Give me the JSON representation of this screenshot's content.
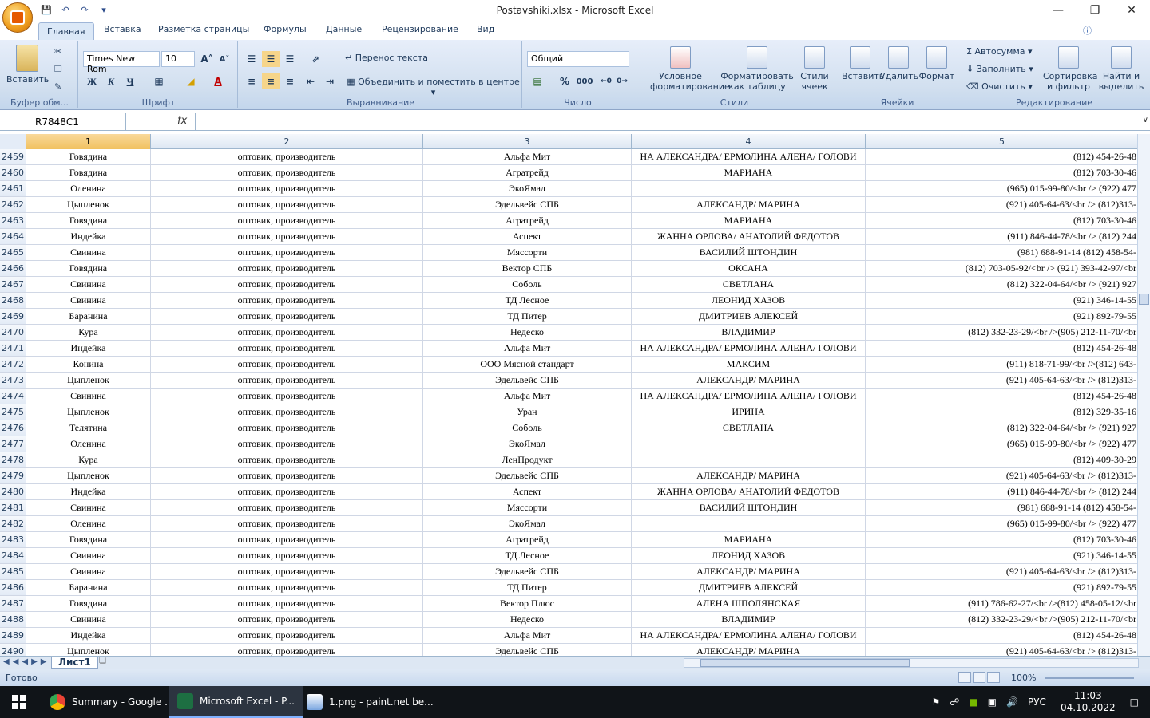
{
  "window": {
    "title": "Postavshiki.xlsx - Microsoft Excel"
  },
  "tabs": [
    "Главная",
    "Вставка",
    "Разметка страницы",
    "Формулы",
    "Данные",
    "Рецензирование",
    "Вид"
  ],
  "ribbon": {
    "clipboard": {
      "paste": "Вставить",
      "label": "Буфер обм..."
    },
    "font": {
      "name": "Times New Rom",
      "size": "10",
      "bold": "Ж",
      "italic": "К",
      "underline": "Ч",
      "label": "Шрифт"
    },
    "align": {
      "wrap": "Перенос текста",
      "merge": "Объединить и поместить в центре",
      "label": "Выравнивание"
    },
    "number": {
      "format": "Общий",
      "percent": "%",
      "thousands": "000",
      "label": "Число"
    },
    "styles": {
      "conditional": "Условное форматирование",
      "as_table": "Форматировать как таблицу",
      "cell_styles": "Стили ячеек",
      "label": "Стили"
    },
    "cells": {
      "insert": "Вставить",
      "delete": "Удалить",
      "format": "Формат",
      "label": "Ячейки"
    },
    "editing": {
      "autosum": "Автосумма",
      "fill": "Заполнить",
      "clear": "Очистить",
      "sort": "Сортировка и фильтр",
      "find": "Найти и выделить",
      "label": "Редактирование"
    }
  },
  "formula_bar": {
    "name_box": "R7848C1",
    "fx": "fx",
    "value": ""
  },
  "columns": [
    "1",
    "2",
    "3",
    "4",
    "5"
  ],
  "rows": [
    [
      "2459",
      "Говядина",
      "оптовик, производитель",
      "Альфа Мит",
      "НА АЛЕКСАНДРА/ ЕРМОЛИНА АЛЕНА/ ГОЛОВИ",
      "(812) 454-26-48"
    ],
    [
      "2460",
      "Говядина",
      "оптовик, производитель",
      "Агратрейд",
      "МАРИАНА",
      "(812) 703-30-46"
    ],
    [
      "2461",
      "Оленина",
      "оптовик, производитель",
      "ЭкоЯмал",
      "",
      "(965) 015-99-80/<br /> (922) 477"
    ],
    [
      "2462",
      "Цыпленок",
      "оптовик, производитель",
      "Эдельвейс СПБ",
      "АЛЕКСАНДР/ МАРИНА",
      "(921) 405-64-63/<br /> (812)313-"
    ],
    [
      "2463",
      "Говядина",
      "оптовик, производитель",
      "Агратрейд",
      "МАРИАНА",
      "(812) 703-30-46"
    ],
    [
      "2464",
      "Индейка",
      "оптовик, производитель",
      "Аспект",
      "ЖАННА ОРЛОВА/ АНАТОЛИЙ ФЕДОТОВ",
      "(911) 846-44-78/<br /> (812) 244"
    ],
    [
      "2465",
      "Свинина",
      "оптовик, производитель",
      "Мяссорти",
      "ВАСИЛИЙ ШТОНДИН",
      "(981) 688-91-14 (812) 458-54-"
    ],
    [
      "2466",
      "Говядина",
      "оптовик, производитель",
      "Вектор СПБ",
      "ОКСАНА",
      "(812) 703-05-92/<br /> (921) 393-42-97/<br"
    ],
    [
      "2467",
      "Свинина",
      "оптовик, производитель",
      "Соболь",
      "СВЕТЛАНА",
      "(812) 322-04-64/<br /> (921) 927"
    ],
    [
      "2468",
      "Свинина",
      "оптовик, производитель",
      "ТД Лесное",
      "ЛЕОНИД ХАЗОВ",
      "(921) 346-14-55"
    ],
    [
      "2469",
      "Баранина",
      "оптовик, производитель",
      "ТД Питер",
      "ДМИТРИЕВ АЛЕКСЕЙ",
      "(921) 892-79-55"
    ],
    [
      "2470",
      "Кура",
      "оптовик, производитель",
      "Недеско",
      "ВЛАДИМИР",
      "(812) 332-23-29/<br />(905) 212-11-70/<br"
    ],
    [
      "2471",
      "Индейка",
      "оптовик, производитель",
      "Альфа Мит",
      "НА АЛЕКСАНДРА/ ЕРМОЛИНА АЛЕНА/ ГОЛОВИ",
      "(812) 454-26-48"
    ],
    [
      "2472",
      "Конина",
      "оптовик, производитель",
      "ООО Мясной стандарт",
      "МАКСИМ",
      "(911) 818-71-99/<br />(812) 643-"
    ],
    [
      "2473",
      "Цыпленок",
      "оптовик, производитель",
      "Эдельвейс СПБ",
      "АЛЕКСАНДР/ МАРИНА",
      "(921) 405-64-63/<br /> (812)313-"
    ],
    [
      "2474",
      "Свинина",
      "оптовик, производитель",
      "Альфа Мит",
      "НА АЛЕКСАНДРА/ ЕРМОЛИНА АЛЕНА/ ГОЛОВИ",
      "(812) 454-26-48"
    ],
    [
      "2475",
      "Цыпленок",
      "оптовик, производитель",
      "Уран",
      "ИРИНА",
      "(812) 329-35-16"
    ],
    [
      "2476",
      "Телятина",
      "оптовик, производитель",
      "Соболь",
      "СВЕТЛАНА",
      "(812) 322-04-64/<br /> (921) 927"
    ],
    [
      "2477",
      "Оленина",
      "оптовик, производитель",
      "ЭкоЯмал",
      "",
      "(965) 015-99-80/<br /> (922) 477"
    ],
    [
      "2478",
      "Кура",
      "оптовик, производитель",
      "ЛенПродукт",
      "",
      "(812) 409-30-29"
    ],
    [
      "2479",
      "Цыпленок",
      "оптовик, производитель",
      "Эдельвейс СПБ",
      "АЛЕКСАНДР/ МАРИНА",
      "(921) 405-64-63/<br /> (812)313-"
    ],
    [
      "2480",
      "Индейка",
      "оптовик, производитель",
      "Аспект",
      "ЖАННА ОРЛОВА/ АНАТОЛИЙ ФЕДОТОВ",
      "(911) 846-44-78/<br /> (812) 244"
    ],
    [
      "2481",
      "Свинина",
      "оптовик, производитель",
      "Мяссорти",
      "ВАСИЛИЙ ШТОНДИН",
      "(981) 688-91-14 (812) 458-54-"
    ],
    [
      "2482",
      "Оленина",
      "оптовик, производитель",
      "ЭкоЯмал",
      "",
      "(965) 015-99-80/<br /> (922) 477"
    ],
    [
      "2483",
      "Говядина",
      "оптовик, производитель",
      "Агратрейд",
      "МАРИАНА",
      "(812) 703-30-46"
    ],
    [
      "2484",
      "Свинина",
      "оптовик, производитель",
      "ТД Лесное",
      "ЛЕОНИД ХАЗОВ",
      "(921) 346-14-55"
    ],
    [
      "2485",
      "Свинина",
      "оптовик, производитель",
      "Эдельвейс СПБ",
      "АЛЕКСАНДР/ МАРИНА",
      "(921) 405-64-63/<br /> (812)313-"
    ],
    [
      "2486",
      "Баранина",
      "оптовик, производитель",
      "ТД Питер",
      "ДМИТРИЕВ АЛЕКСЕЙ",
      "(921) 892-79-55"
    ],
    [
      "2487",
      "Говядина",
      "оптовик, производитель",
      "Вектор Плюс",
      "АЛЕНА ШПОЛЯНСКАЯ",
      "(911) 786-62-27/<br />(812) 458-05-12/<br"
    ],
    [
      "2488",
      "Свинина",
      "оптовик, производитель",
      "Недеско",
      "ВЛАДИМИР",
      "(812) 332-23-29/<br />(905) 212-11-70/<br"
    ],
    [
      "2489",
      "Индейка",
      "оптовик, производитель",
      "Альфа Мит",
      "НА АЛЕКСАНДРА/ ЕРМОЛИНА АЛЕНА/ ГОЛОВИ",
      "(812) 454-26-48"
    ],
    [
      "2490",
      "Цыпленок",
      "оптовик, производитель",
      "Эдельвейс СПБ",
      "АЛЕКСАНДР/ МАРИНА",
      "(921) 405-64-63/<br /> (812)313-"
    ]
  ],
  "sheet": {
    "tab": "Лист1"
  },
  "status": {
    "text": "Готово",
    "zoom": "100%"
  },
  "taskbar": {
    "items": [
      "Summary - Google ...",
      "Microsoft Excel - P...",
      "1.png - paint.net be..."
    ],
    "lang": "РУС",
    "time": "11:03",
    "date": "04.10.2022"
  }
}
